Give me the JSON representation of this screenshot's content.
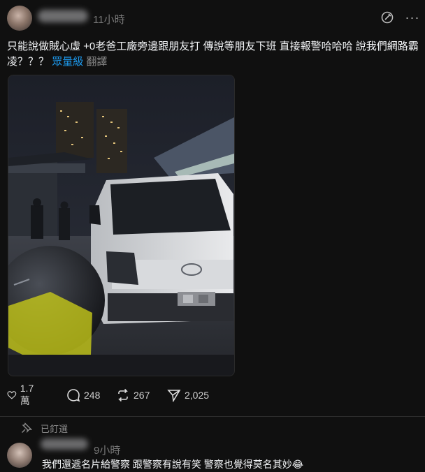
{
  "post": {
    "time": "11小時",
    "text_main": "只能說做賊心虛 +0老爸工廠旁邊跟朋友打 傳說等朋友下班 直接報警哈哈哈 說我們網路霸凌？？？",
    "tag": "眾量級",
    "translate": "翻譯",
    "photo_icon": "photo-of-white-van-at-night",
    "actions": {
      "like_count": "1.7 萬",
      "comment_count": "248",
      "repost_count": "267",
      "share_count": "2,025"
    }
  },
  "pinned": {
    "label": "已釘選"
  },
  "reply": {
    "time": "9小時",
    "text": "我們還遞名片給警察 跟警察有說有笑 警察也覺得莫名其妙😂"
  },
  "colors": {
    "background": "#101010",
    "text_primary": "#f3f5f7",
    "text_muted": "#777777",
    "link": "#1d9bf0"
  }
}
